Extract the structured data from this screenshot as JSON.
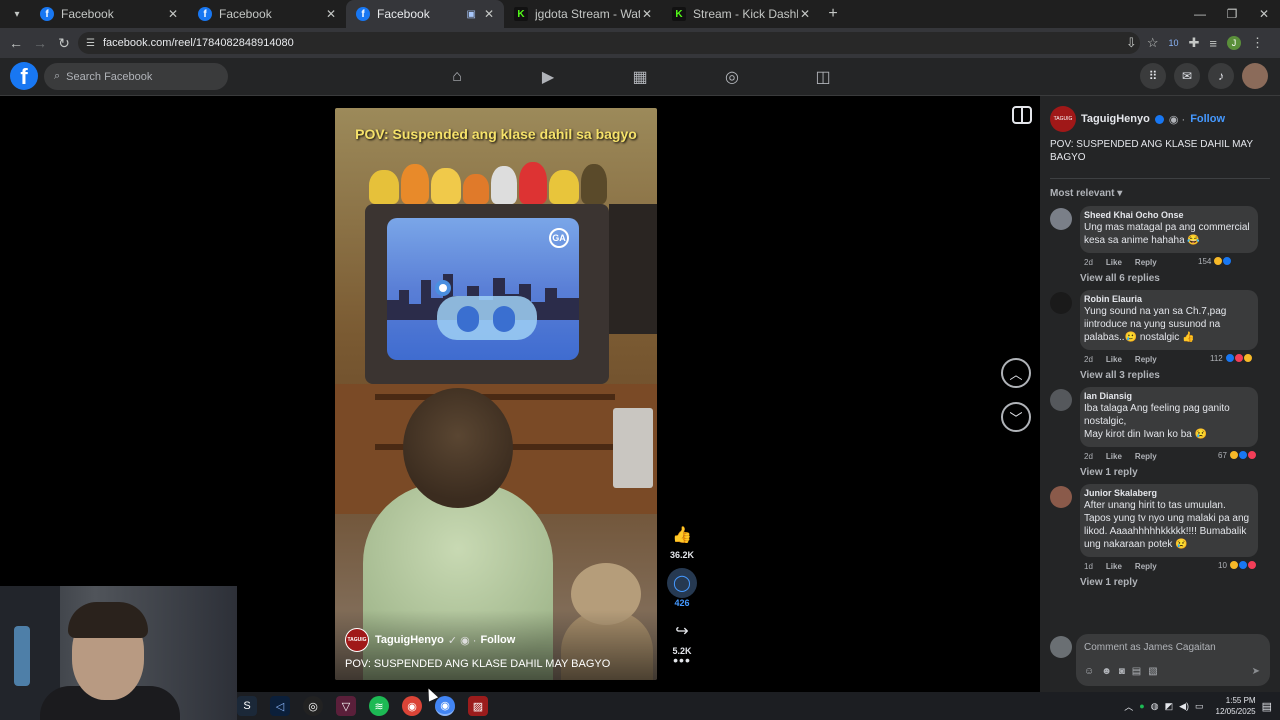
{
  "browser": {
    "tabs": [
      {
        "title": "Facebook",
        "icon": "facebook-icon"
      },
      {
        "title": "Facebook",
        "icon": "facebook-icon"
      },
      {
        "title": "Facebook",
        "icon": "facebook-icon"
      },
      {
        "title": "jgdota Stream - Watch Live on K",
        "icon": "kick-icon"
      },
      {
        "title": "Stream - Kick Dashboard",
        "icon": "kick-icon"
      }
    ],
    "url": "facebook.com/reel/1784082848914080",
    "profile_initial": "J",
    "extension_badge": "10"
  },
  "facebook": {
    "search_placeholder": "Search Facebook",
    "nav": [
      "home-icon",
      "reels-icon",
      "marketplace-icon",
      "groups-icon",
      "gaming-icon"
    ],
    "right": [
      "menu-grid-icon",
      "messenger-icon",
      "notifications-icon",
      "profile-avatar"
    ]
  },
  "reel": {
    "overlay_text": "POV: Suspended ang klase dahil sa bagyo",
    "channel_logo_text": "GA",
    "author": "TaguigHenyo",
    "follow": "Follow",
    "caption": "POV: SUSPENDED ANG KLASE DAHIL MAY BAGYO",
    "likes": "36.2K",
    "comments": "426",
    "shares": "5.2K"
  },
  "panel": {
    "author": "TaguigHenyo",
    "follow": "Follow",
    "caption": "POV: SUSPENDED ANG KLASE DAHIL MAY BAGYO",
    "sort": "Most relevant",
    "comments": [
      {
        "name": "Sheed Khai Ocho Onse",
        "text": "Ung mas matagal pa ang commercial kesa sa anime hahaha 😂",
        "time": "2d",
        "like": "Like",
        "reply": "Reply",
        "reaction_count": "154",
        "replies": "View all 6 replies",
        "avatar_color": "#7a7f88"
      },
      {
        "name": "Robin Elauria",
        "text": "Yung sound na yan sa Ch.7,pag iintroduce na yung susunod na palabas..🥲 nostalgic 👍",
        "time": "2d",
        "like": "Like",
        "reply": "Reply",
        "reaction_count": "112",
        "replies": "View all 3 replies",
        "avatar_color": "#1a1a1a"
      },
      {
        "name": "Ian Diansig",
        "text": "Iba talaga Ang feeling pag ganito nostalgic,\nMay kirot din Iwan ko ba 😢",
        "time": "2d",
        "like": "Like",
        "reply": "Reply",
        "reaction_count": "67",
        "replies": "View 1 reply",
        "avatar_color": "#55585c"
      },
      {
        "name": "Junior Skalaberg",
        "text": "After unang hirit to tas umuulan. Tapos yung tv nyo ung malaki pa ang likod. Aaaahhhhhkkkkk!!!! Bumabalik ung nakaraan potek 😢",
        "time": "1d",
        "like": "Like",
        "reply": "Reply",
        "reaction_count": "10",
        "replies": "View 1 reply",
        "avatar_color": "#8a5a4a"
      }
    ],
    "compose_placeholder": "Comment as James Cagaitan"
  },
  "taskbar": {
    "time": "1:55 PM",
    "date": "12/05/2025"
  },
  "colors": {
    "accent": "#4599ff",
    "fb_blue": "#1877f2",
    "panel_bg": "#242526",
    "bubble_bg": "#3a3b3c"
  }
}
